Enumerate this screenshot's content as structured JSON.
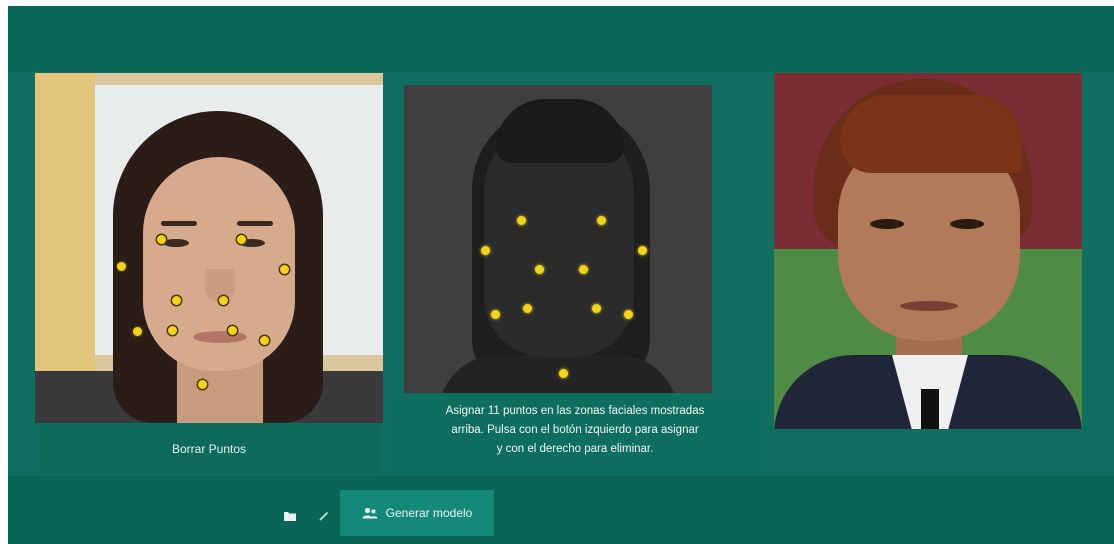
{
  "colors": {
    "background": "#0f6e60",
    "topbar": "#0a6657",
    "toolbar": "#0a6557",
    "accent_button": "#14897a",
    "landmark_dot": "#f2d21b"
  },
  "photo_panel": {
    "clear_button_label": "Borrar Puntos"
  },
  "reference_panel": {
    "instruction_lines": [
      "Asignar 11 puntos en las zonas faciales mostradas",
      "arriba. Pulsa con el botón izquierdo para asignar",
      "y con el derecho para eliminar."
    ]
  },
  "toolbar": {
    "folder_icon": "folder-icon",
    "edit_icon": "pencil-icon",
    "generate_icon": "user-group-icon",
    "generate_label": "Generar modelo"
  }
}
